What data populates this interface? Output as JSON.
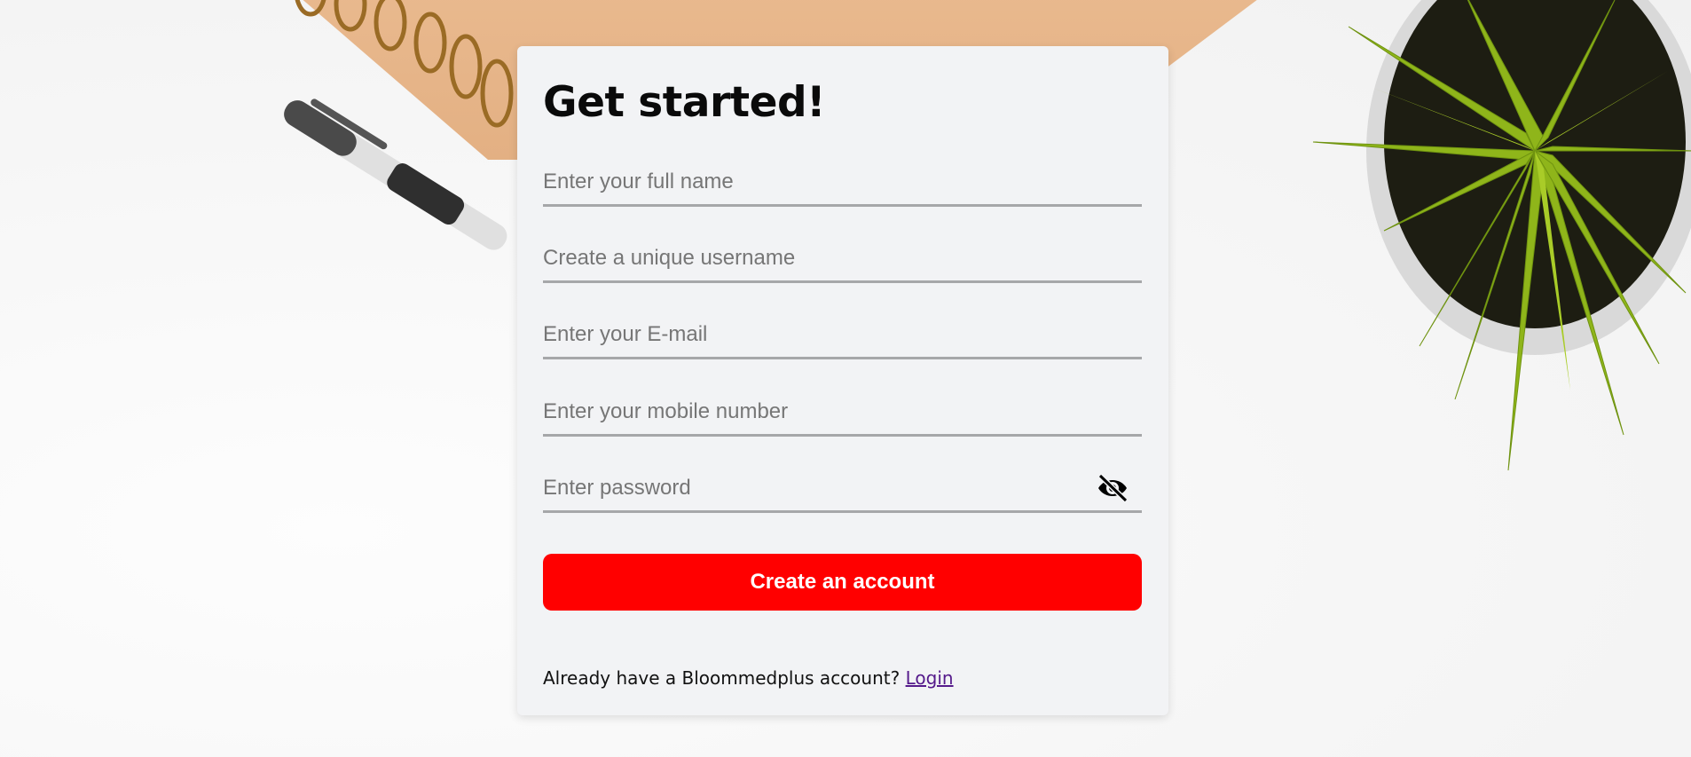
{
  "form": {
    "title": "Get started!",
    "fields": [
      {
        "name": "full-name",
        "placeholder": "Enter your full name",
        "value": ""
      },
      {
        "name": "username",
        "placeholder": "Create a unique username",
        "value": ""
      },
      {
        "name": "email",
        "placeholder": "Enter your E-mail",
        "value": ""
      },
      {
        "name": "mobile",
        "placeholder": "Enter your mobile number",
        "value": ""
      },
      {
        "name": "password",
        "placeholder": "Enter password",
        "value": ""
      }
    ],
    "password_toggle_icon": "eye-slash-icon",
    "submit_label": "Create an account",
    "footer_text": "Already have a Bloommedplus account?",
    "login_link": "Login"
  },
  "colors": {
    "accent": "#ff0000",
    "card_background": "#f2f3f5",
    "link": "#551a8b"
  },
  "background_decorations": [
    "spiral-notebook",
    "pen",
    "potted-plant"
  ]
}
